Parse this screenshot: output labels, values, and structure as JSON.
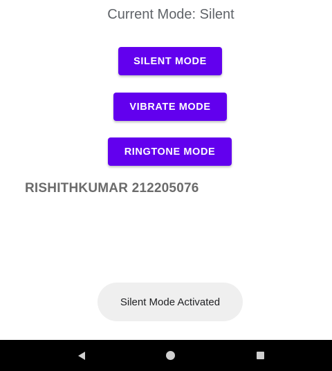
{
  "status": {
    "current_mode_text": "Current Mode: Silent"
  },
  "buttons": {
    "silent_label": "SILENT MODE",
    "vibrate_label": "VIBRATE MODE",
    "ringtone_label": "RINGTONE MODE"
  },
  "footer": {
    "name_text": "RISHITHKUMAR 212205076"
  },
  "toast": {
    "message": "Silent Mode Activated"
  },
  "nav": {
    "back_icon": "back-triangle-icon",
    "home_icon": "home-circle-icon",
    "recents_icon": "recents-square-icon"
  },
  "colors": {
    "accent": "#6200ee",
    "navbar": "#000000",
    "toast_bg": "#efefef"
  }
}
